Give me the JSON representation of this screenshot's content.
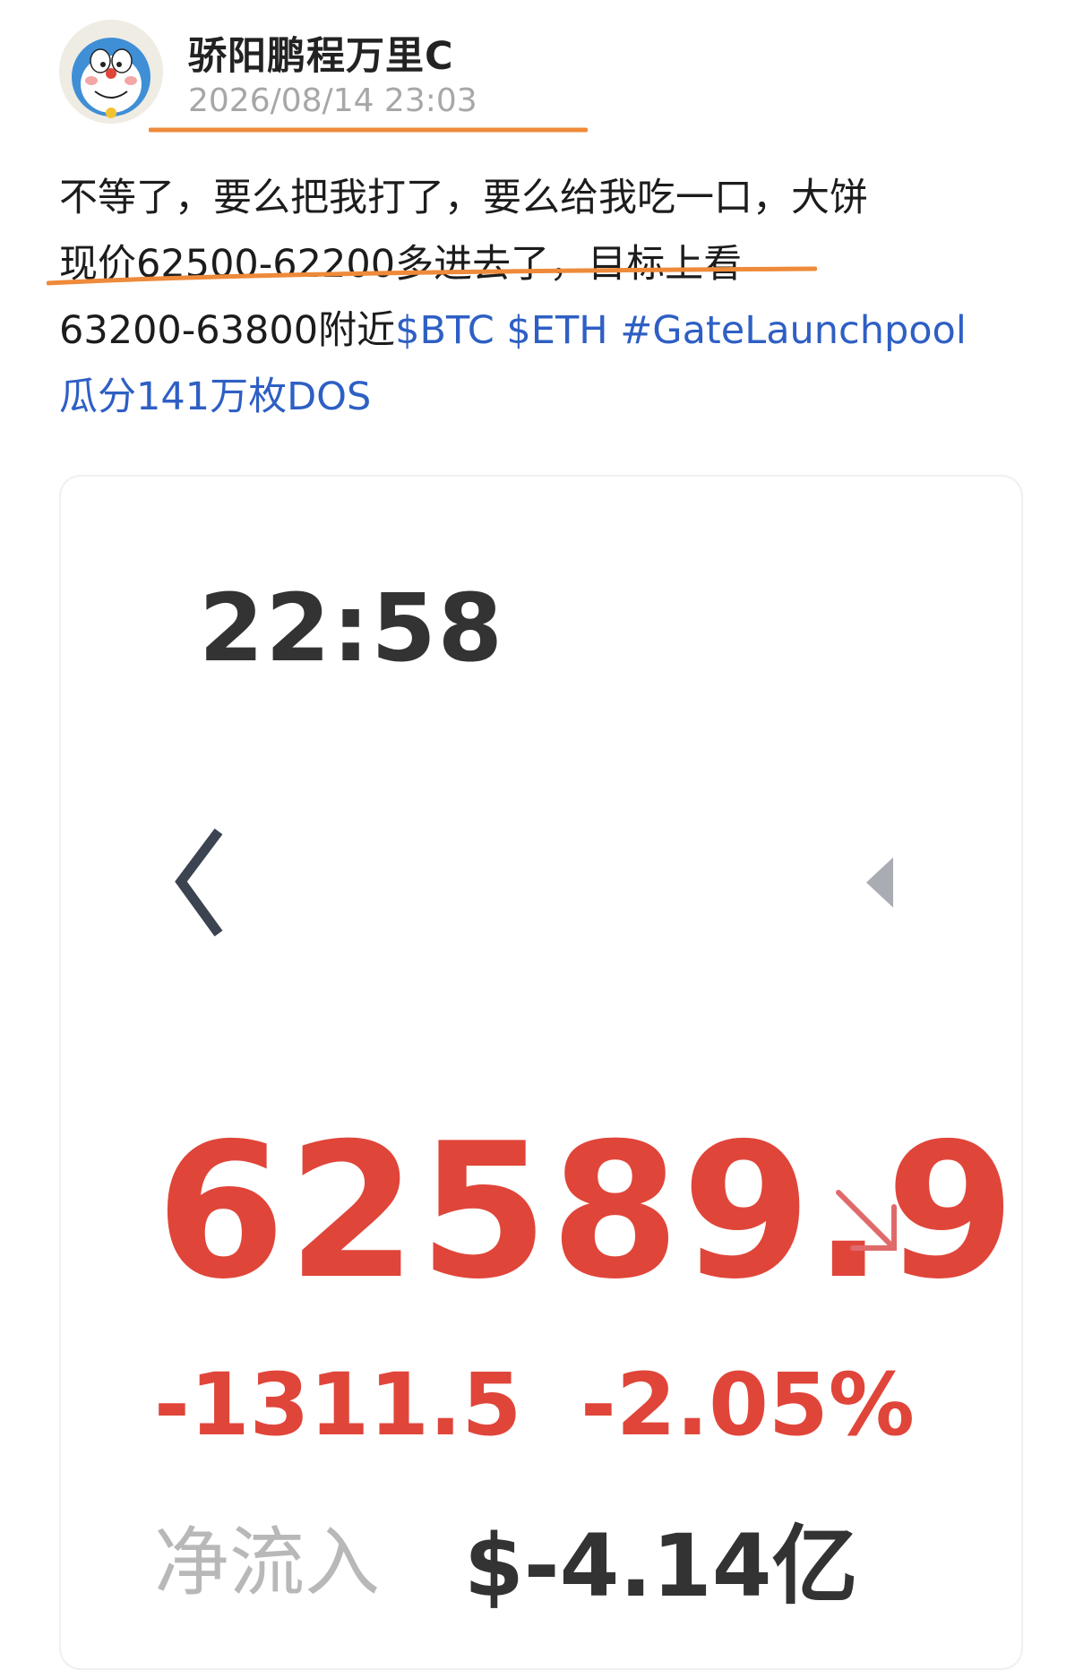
{
  "post": {
    "author": "骄阳鹏程万里C",
    "timestamp": "2026/08/14 23:03",
    "body": {
      "line1": "不等了，要么把我打了，要么给我吃一口，大饼",
      "line2": "现价62500-62200多进去了，目标上看",
      "line3_text": "63200-63800附近",
      "tag_btc": "$BTC",
      "tag_eth": "$ETH",
      "tag_launchpool": "#GateLaunchpool",
      "line4": "瓜分141万枚DOS"
    },
    "highlight_color": "#ee8a3a",
    "link_color": "#2e5fc4"
  },
  "card": {
    "time": "22:58",
    "price": "62589.9",
    "change_abs": "-1311.5",
    "change_pct": "-2.05%",
    "inflow_label": "净流入",
    "inflow_value": "$-4.14亿",
    "down_color": "#e0453a",
    "icons": {
      "back": "chevron-left-icon",
      "play": "triangle-left-icon",
      "trend": "arrow-down-right-icon"
    }
  }
}
